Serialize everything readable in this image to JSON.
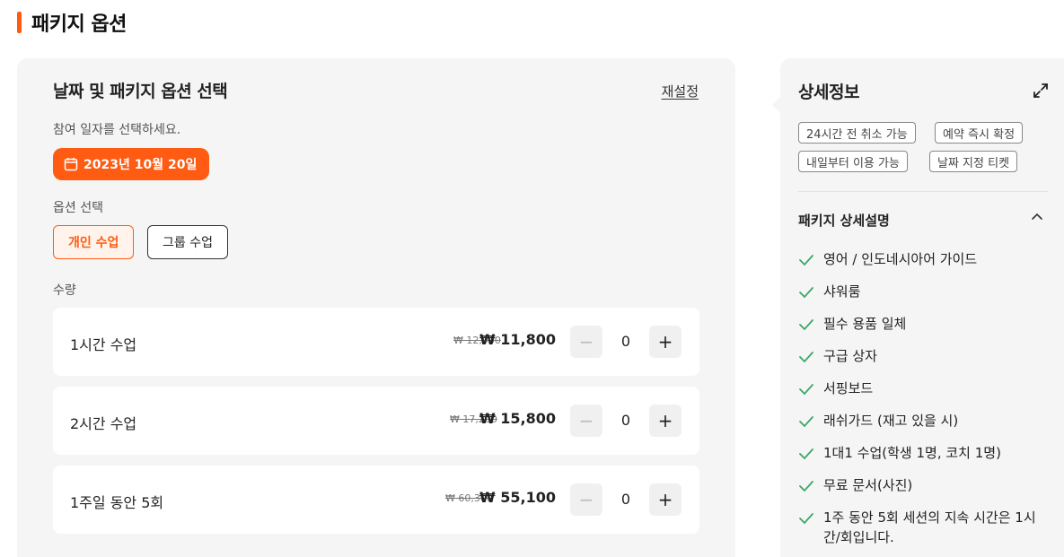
{
  "page": {
    "title": "패키지 옵션"
  },
  "left": {
    "title": "날짜 및 패키지 옵션 선택",
    "reset_label": "재설정",
    "date_prompt": "참여 일자를 선택하세요.",
    "selected_date": "2023년 10월 20일",
    "option_label": "옵션 선택",
    "options": [
      {
        "label": "개인 수업",
        "selected": true
      },
      {
        "label": "그룹 수업",
        "selected": false
      }
    ],
    "quantity_label": "수량",
    "items": [
      {
        "name": "1시간 수업",
        "original_price": "₩ 12,900",
        "price": "₩ 11,800",
        "count": "0"
      },
      {
        "name": "2시간 수업",
        "original_price": "₩ 17,200",
        "price": "₩ 15,800",
        "count": "0"
      },
      {
        "name": "1주일 동안 5회",
        "original_price": "₩ 60,300",
        "price": "₩ 55,100",
        "count": "0"
      }
    ],
    "minus_symbol": "−",
    "plus_symbol": "+"
  },
  "right": {
    "title": "상세정보",
    "tags": [
      "24시간 전 취소 가능",
      "예약 즉시 확정",
      "내일부터 이용 가능",
      "날짜 지정 티켓"
    ],
    "package_title": "패키지 상세설명",
    "features": [
      "영어 / 인도네시아어 가이드",
      "샤워룸",
      "필수 용품 일체",
      "구급 상자",
      "서핑보드",
      "래쉬가드 (재고 있을 시)",
      "1대1 수업(학생 1명, 코치 1명)",
      "무료 문서(사진)",
      "1주 동안 5회 세션의 지속 시간은 1시간/회입니다."
    ]
  },
  "colors": {
    "accent": "#ff5b12",
    "check": "#3aa66a",
    "panel_bg": "#f5f5f5"
  },
  "icons": {
    "date": "calendar-icon",
    "expand": "expand-icon",
    "collapse": "chevron-up-icon",
    "feature": "check-icon"
  }
}
